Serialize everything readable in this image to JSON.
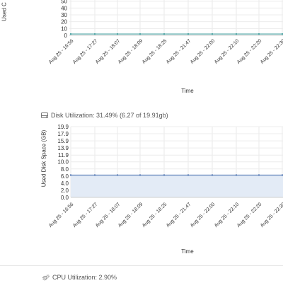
{
  "memory_panel": {
    "ylabel": "Used C",
    "xlabel": "Time"
  },
  "disk_panel": {
    "icon": "hdd-icon",
    "title": "Disk Utilization: 31.49% (6.27 of 19.91gb)",
    "ylabel": "Used Disk Space (GB)",
    "xlabel": "Time"
  },
  "cpu_panel": {
    "icon": "cogs-icon",
    "title": "CPU Utilization: 2.90%"
  },
  "chart_data": [
    {
      "type": "area",
      "title": "",
      "xlabel": "Time",
      "ylabel": "Used C",
      "ytick_labels": [
        "0",
        "10",
        "20",
        "30",
        "40",
        "50"
      ],
      "categories": [
        "Aug 25 - 16:56",
        "Aug 25 - 17:27",
        "Aug 25 - 18:07",
        "Aug 25 - 18:09",
        "Aug 25 - 18:25",
        "Aug 25 - 21:47",
        "Aug 25 - 22:00",
        "Aug 25 - 22:10",
        "Aug 25 - 22:20",
        "Aug 25 - 22:30",
        "Aug 25"
      ],
      "values": [
        2,
        2,
        2,
        2,
        2,
        2,
        2,
        2,
        2,
        2,
        2
      ],
      "color": "#4aa3a3",
      "grid": true
    },
    {
      "type": "area",
      "title": "Disk Utilization: 31.49% (6.27 of 19.91gb)",
      "xlabel": "Time",
      "ylabel": "Used Disk Space (GB)",
      "ytick_labels": [
        "19.9",
        "17.9",
        "15.9",
        "13.9",
        "11.9",
        "10.0",
        "8.0",
        "6.0",
        "4.0",
        "2.0",
        "0.0"
      ],
      "ylim": [
        0,
        19.9
      ],
      "categories": [
        "Aug 25 - 16:56",
        "Aug 25 - 17:27",
        "Aug 25 - 18:07",
        "Aug 25 - 18:09",
        "Aug 25 - 18:25",
        "Aug 25 - 21:47",
        "Aug 25 - 22:00",
        "Aug 25 - 22:10",
        "Aug 25 - 22:20",
        "Aug 25 - 22:30",
        "Aug 25"
      ],
      "values": [
        6.27,
        6.27,
        6.27,
        6.27,
        6.27,
        6.27,
        6.27,
        6.27,
        6.27,
        6.27,
        6.27
      ],
      "color": "#5b7fb8",
      "fill": "#e3ebf6",
      "grid": true
    }
  ]
}
